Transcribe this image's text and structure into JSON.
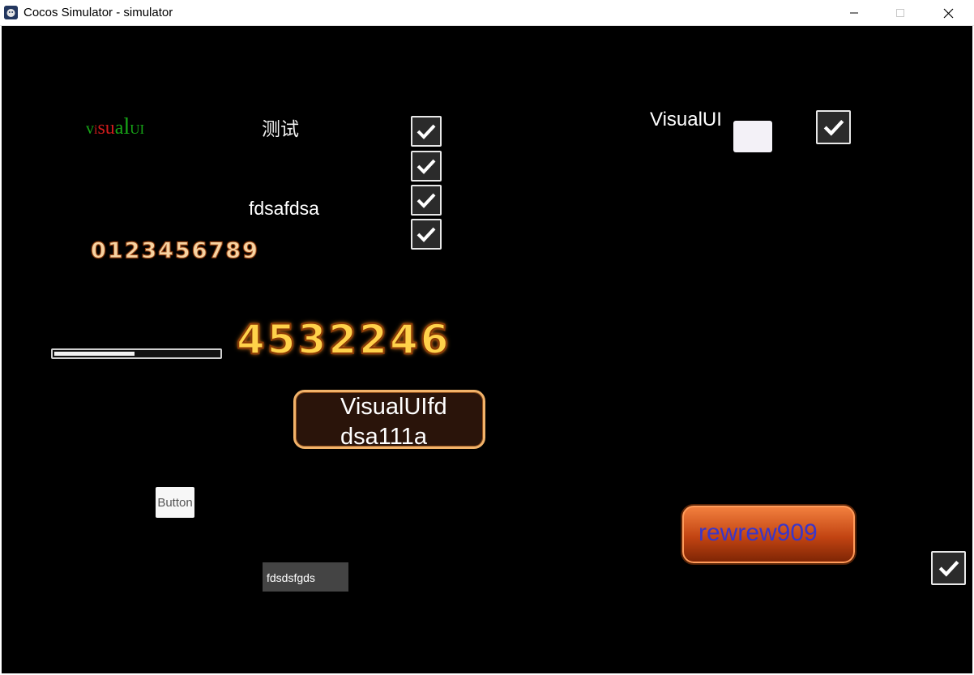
{
  "window": {
    "title": "Cocos Simulator - simulator"
  },
  "canvas": {
    "visual_ui_colored": [
      {
        "ch": "v",
        "color": "#17a417",
        "size": 20
      },
      {
        "ch": "i",
        "color": "#d01c1c",
        "size": 16
      },
      {
        "ch": "s",
        "color": "#d01c1c",
        "size": 24
      },
      {
        "ch": "u",
        "color": "#d01c1c",
        "size": 24
      },
      {
        "ch": "a",
        "color": "#17a417",
        "size": 24
      },
      {
        "ch": "l",
        "color": "#17a417",
        "size": 28
      },
      {
        "ch": "U",
        "color": "#17a417",
        "size": 17
      },
      {
        "ch": "I",
        "color": "#17a417",
        "size": 17
      }
    ],
    "chinese_label": "测试",
    "label_fdsafdsa": "fdsafdsa",
    "digits_small": "0123456789",
    "digits_big": "4532246",
    "slider_progress_percent": 49,
    "brown_button_label": "VisualUIfd\ndsa111a",
    "small_button_label": "Button",
    "text_field_value": "fdsdsfgds",
    "orange_button_label": "rewrew909",
    "label_visualui": "VisualUI"
  },
  "colors": {
    "background": "#000000",
    "orange_button_text": "#3a36c9"
  }
}
